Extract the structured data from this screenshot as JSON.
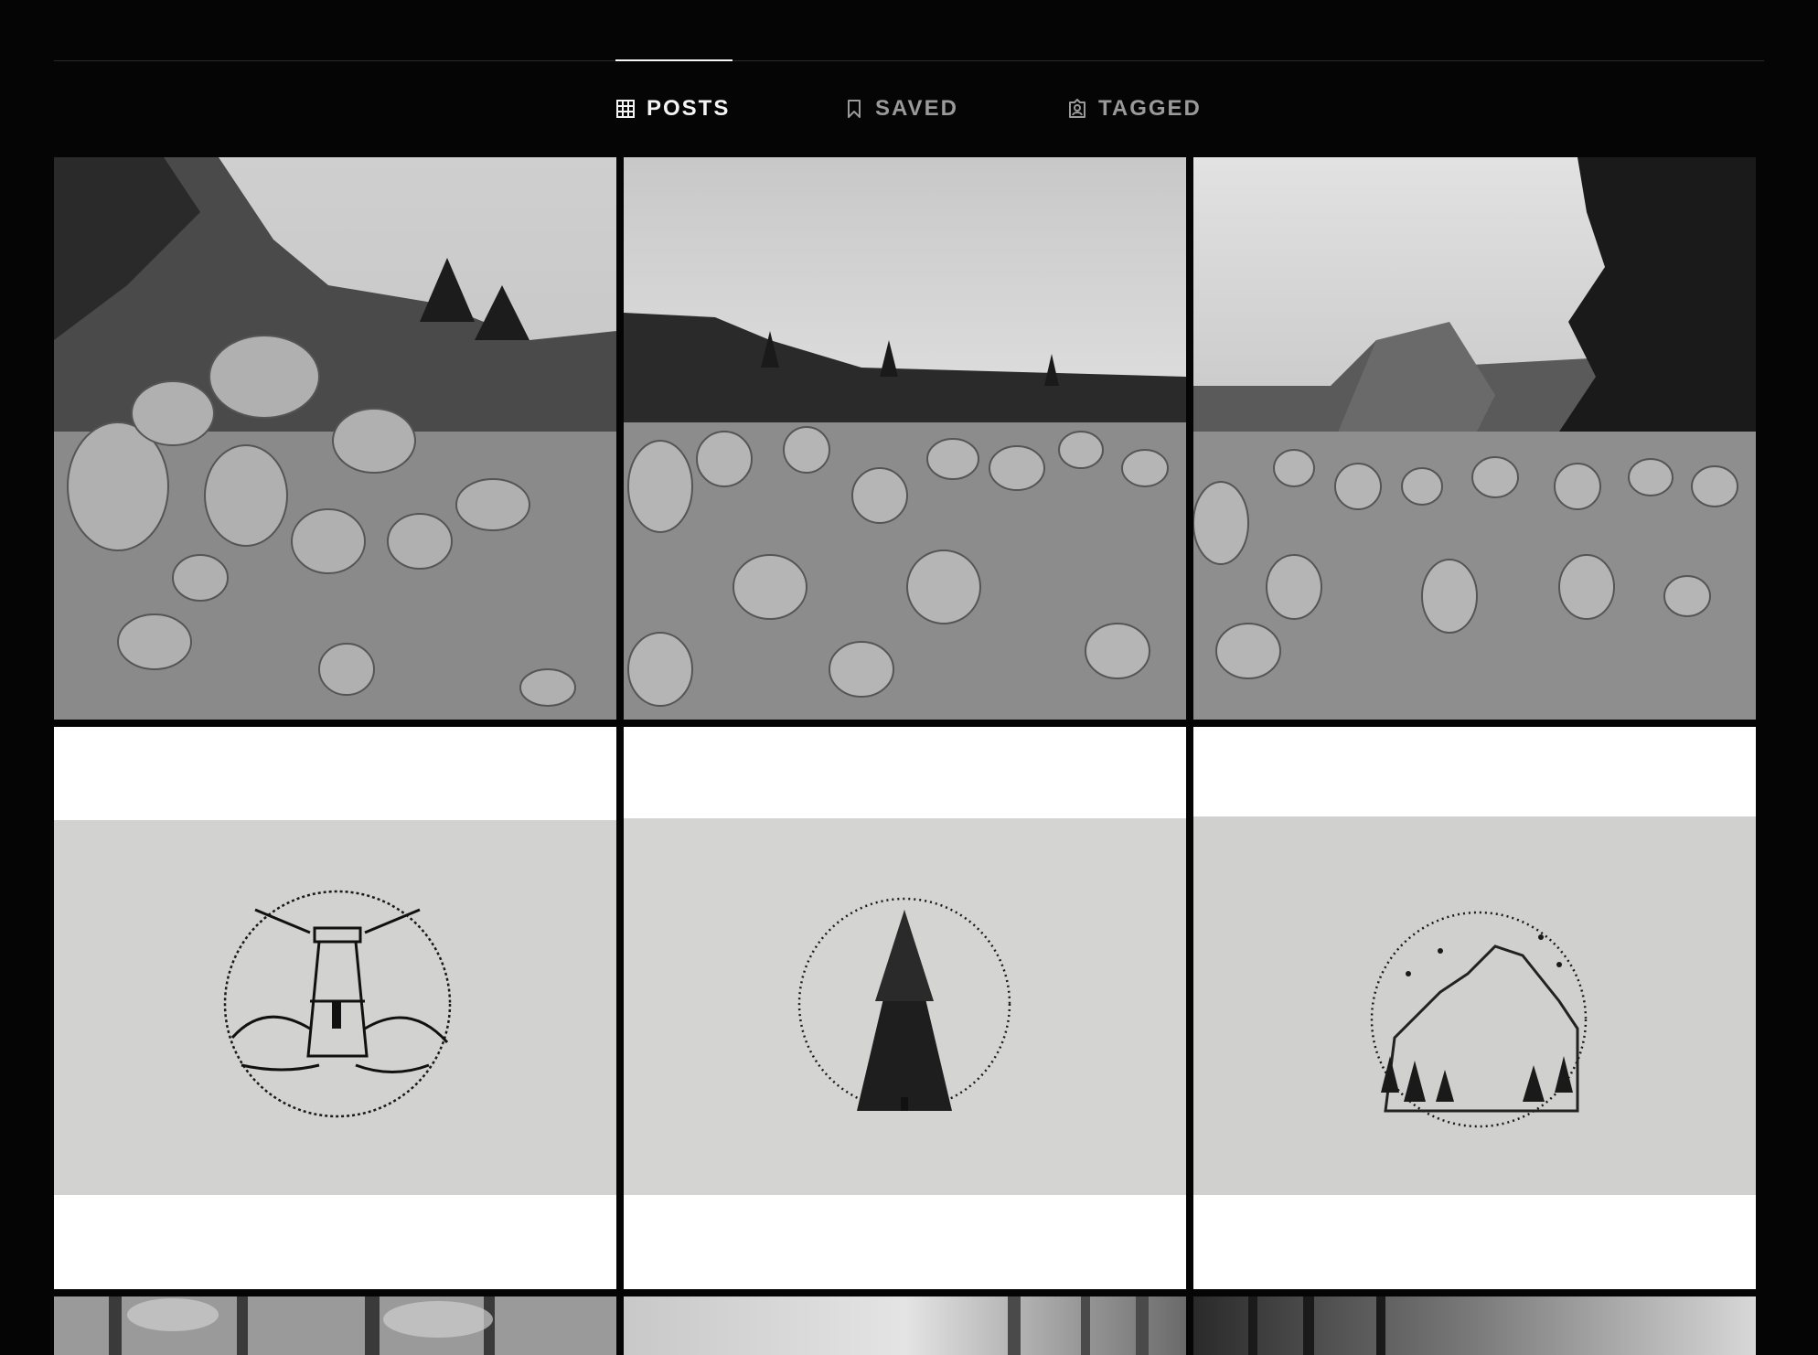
{
  "tabs": [
    {
      "label": "POSTS",
      "icon": "grid-icon",
      "active": true
    },
    {
      "label": "SAVED",
      "icon": "bookmark-icon",
      "active": false
    },
    {
      "label": "TAGGED",
      "icon": "tagged-person-icon",
      "active": false
    }
  ],
  "posts": [
    {
      "kind": "photo",
      "subject": "stone cairns on rocky slope"
    },
    {
      "kind": "photo",
      "subject": "field of stone cairns with misty forest"
    },
    {
      "kind": "photo",
      "subject": "stone cairns with fir tree and mountain"
    },
    {
      "kind": "drawing",
      "subject": "lighthouse stippling illustration"
    },
    {
      "kind": "drawing",
      "subject": "fir tree stippling illustration"
    },
    {
      "kind": "drawing",
      "subject": "mountain stippling illustration"
    },
    {
      "kind": "photo",
      "subject": "forest"
    },
    {
      "kind": "photo",
      "subject": "foggy forest"
    },
    {
      "kind": "photo",
      "subject": "dark forest with light"
    }
  ],
  "colors": {
    "background": "#050505",
    "tab_active": "#f5f5f5",
    "tab_inactive": "#9a9a9a",
    "divider": "#2a2a2a"
  }
}
